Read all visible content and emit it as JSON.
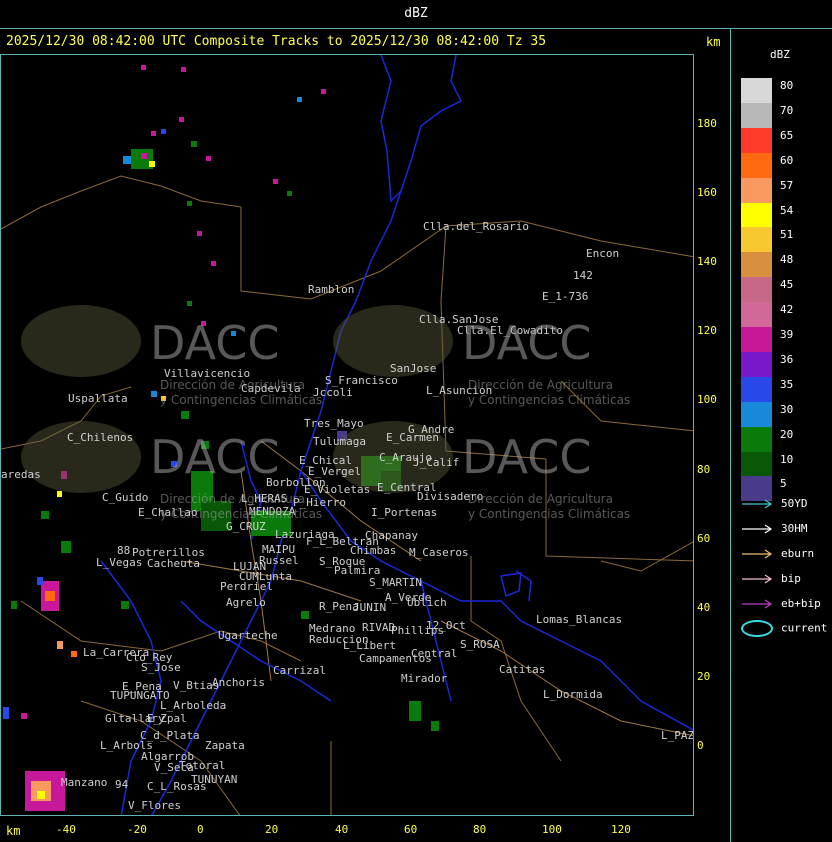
{
  "window": {
    "title": "dBZ"
  },
  "header": {
    "product_line": "2025/12/30 08:42:00 UTC Composite Tracks to 2025/12/30 08:42:00 Tz 35",
    "unit_top": "km",
    "unit_bottom": "km"
  },
  "axes": {
    "x_ticks": [
      "-40",
      "-20",
      "0",
      "20",
      "40",
      "60",
      "80",
      "100",
      "120"
    ],
    "y_ticks": [
      "180",
      "160",
      "140",
      "120",
      "100",
      "80",
      "60",
      "40",
      "20",
      "0"
    ]
  },
  "legend": {
    "title": "dBZ",
    "scale": [
      {
        "label": "80",
        "color": "#d8d8d8"
      },
      {
        "label": "70",
        "color": "#b8b8b8"
      },
      {
        "label": "65",
        "color": "#ff3a2a"
      },
      {
        "label": "60",
        "color": "#ff6a10"
      },
      {
        "label": "57",
        "color": "#f89a60"
      },
      {
        "label": "54",
        "color": "#ffff00"
      },
      {
        "label": "51",
        "color": "#f8c830"
      },
      {
        "label": "48",
        "color": "#d89040"
      },
      {
        "label": "45",
        "color": "#c86888"
      },
      {
        "label": "42",
        "color": "#d06898"
      },
      {
        "label": "39",
        "color": "#c8189a"
      },
      {
        "label": "36",
        "color": "#7818c8"
      },
      {
        "label": "35",
        "color": "#2848e8"
      },
      {
        "label": "30",
        "color": "#1888d8"
      },
      {
        "label": "20",
        "color": "#0a7a0a"
      },
      {
        "label": "10",
        "color": "#085808"
      },
      {
        "label": "5",
        "color": "#4a3a8a"
      }
    ],
    "tracks": [
      {
        "label": "50YD",
        "color": "#40c8d0"
      },
      {
        "label": "30HM",
        "color": "#ffffff"
      },
      {
        "label": "eburn",
        "color": "#f0c070"
      },
      {
        "label": "bip",
        "color": "#f0c0d0"
      },
      {
        "label": "eb+bip",
        "color": "#c040c0"
      }
    ],
    "current_label": "current",
    "current_color": "#3ad8e0"
  },
  "watermark": {
    "logo": "DACC",
    "line1": "Dirección de Agricultura",
    "line2": "y Contingencias Climáticas"
  },
  "places": [
    {
      "name": "Clla.del_Rosario"
    },
    {
      "name": "Encon"
    },
    {
      "name": "142"
    },
    {
      "name": "E_1-736"
    },
    {
      "name": "Ramblon"
    },
    {
      "name": "Clla.SanJose"
    },
    {
      "name": "Clla.El_Cowadito"
    },
    {
      "name": "Villavicencio"
    },
    {
      "name": "Capdevila"
    },
    {
      "name": "S_Francisco"
    },
    {
      "name": "Jccoli"
    },
    {
      "name": "SanJose"
    },
    {
      "name": "L_Asuncion"
    },
    {
      "name": "Uspallata"
    },
    {
      "name": "Tres_Mayo"
    },
    {
      "name": "G_Andre"
    },
    {
      "name": "C_Chilenos"
    },
    {
      "name": "Tulumaga"
    },
    {
      "name": "E_Carmen"
    },
    {
      "name": "E_Chical"
    },
    {
      "name": "C_Araujo"
    },
    {
      "name": "J_Calif"
    },
    {
      "name": "E_Vergel"
    },
    {
      "name": "aredas"
    },
    {
      "name": "Borbollon"
    },
    {
      "name": "E_Violetas"
    },
    {
      "name": "E_Central"
    },
    {
      "name": "Divisadero"
    },
    {
      "name": "C_Guido"
    },
    {
      "name": "L_HERAS"
    },
    {
      "name": "P_Hierro"
    },
    {
      "name": "E_Challao"
    },
    {
      "name": "MENDOZA"
    },
    {
      "name": "I_Portenas"
    },
    {
      "name": "G_CRUZ"
    },
    {
      "name": "Lazuriaga"
    },
    {
      "name": "Chapanay"
    },
    {
      "name": "MAIPU"
    },
    {
      "name": "F_L_Beltran"
    },
    {
      "name": "Potrerillos"
    },
    {
      "name": "Russel"
    },
    {
      "name": "Chimbas"
    },
    {
      "name": "M_Caseros"
    },
    {
      "name": "L_Vegas"
    },
    {
      "name": "Cacheuta"
    },
    {
      "name": "LUJAN"
    },
    {
      "name": "S_Roque"
    },
    {
      "name": "CUMLunta"
    },
    {
      "name": "Palmira"
    },
    {
      "name": "Perdriel"
    },
    {
      "name": "S_MARTIN"
    },
    {
      "name": "A_Verde"
    },
    {
      "name": "Agrelo"
    },
    {
      "name": "Ublich"
    },
    {
      "name": "R_Pena"
    },
    {
      "name": "JUNIN"
    },
    {
      "name": "Lomas_Blancas"
    },
    {
      "name": "Medrano"
    },
    {
      "name": "RIVAD"
    },
    {
      "name": "Phillips"
    },
    {
      "name": "12_Oct"
    },
    {
      "name": "Ugarteche"
    },
    {
      "name": "Reduccion"
    },
    {
      "name": "S_ROSA"
    },
    {
      "name": "La_Carrera"
    },
    {
      "name": "Cto_Rey"
    },
    {
      "name": "L_Libert"
    },
    {
      "name": "Central"
    },
    {
      "name": "S_Jose"
    },
    {
      "name": "Campamentos"
    },
    {
      "name": "Carrizal"
    },
    {
      "name": "Catitas"
    },
    {
      "name": "E_Pena"
    },
    {
      "name": "V_Btias"
    },
    {
      "name": "Anchoris"
    },
    {
      "name": "Mirador"
    },
    {
      "name": "TUPUNGATO"
    },
    {
      "name": "L_Dormida"
    },
    {
      "name": "L_Arboleda"
    },
    {
      "name": "Gltallary"
    },
    {
      "name": "E_Zpal"
    },
    {
      "name": "C_d_Plata"
    },
    {
      "name": "L_PAZ"
    },
    {
      "name": "L_Arbols"
    },
    {
      "name": "Zapata"
    },
    {
      "name": "Algarrob"
    },
    {
      "name": "V_Seca"
    },
    {
      "name": "Totoral"
    },
    {
      "name": "Manzano"
    },
    {
      "name": "TUNUYAN"
    },
    {
      "name": "C_L_Rosas"
    },
    {
      "name": "V_Flores"
    },
    {
      "name": "88"
    },
    {
      "name": "94"
    }
  ]
}
